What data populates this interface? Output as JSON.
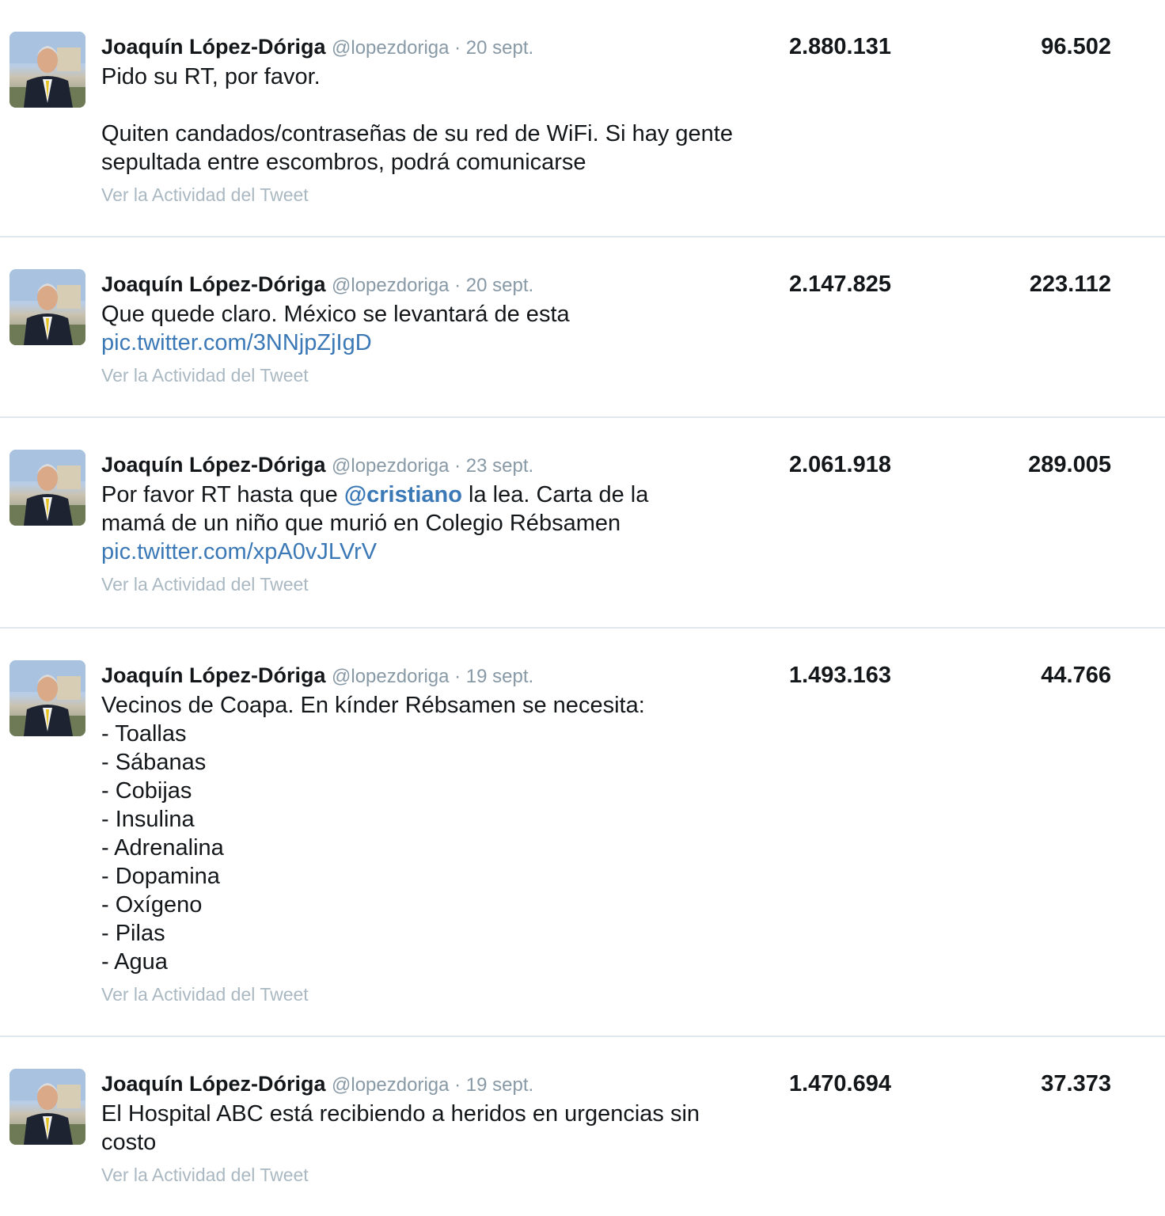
{
  "tweets": [
    {
      "name": "Joaquín López-Dóriga",
      "handle": "@lopezdoriga",
      "sep": " · ",
      "date": "20 sept.",
      "text_parts": [
        {
          "type": "text",
          "value": "Pido su RT, por favor.\n\nQuiten candados/contraseñas de su red de WiFi. Si hay gente sepultada entre escombros, podrá comunicarse"
        }
      ],
      "activity_label": "Ver la Actividad del Tweet",
      "impressions": "2.880.131",
      "engagements": "96.502"
    },
    {
      "name": "Joaquín López-Dóriga",
      "handle": "@lopezdoriga",
      "sep": " · ",
      "date": "20 sept.",
      "text_parts": [
        {
          "type": "text",
          "value": "Que quede claro. México se levantará de esta\n"
        },
        {
          "type": "link",
          "value": "pic.twitter.com/3NNjpZjIgD"
        }
      ],
      "activity_label": "Ver la Actividad del Tweet",
      "impressions": "2.147.825",
      "engagements": "223.112"
    },
    {
      "name": "Joaquín López-Dóriga",
      "handle": "@lopezdoriga",
      "sep": " · ",
      "date": "23 sept.",
      "text_parts": [
        {
          "type": "text",
          "value": "Por favor RT hasta que "
        },
        {
          "type": "mention",
          "value": "@cristiano"
        },
        {
          "type": "text",
          "value": " la lea. Carta de la\nmamá de un niño que murió en Colegio Rébsamen\n"
        },
        {
          "type": "link",
          "value": "pic.twitter.com/xpA0vJLVrV"
        }
      ],
      "activity_label": "Ver la Actividad del Tweet",
      "impressions": "2.061.918",
      "engagements": "289.005"
    },
    {
      "name": "Joaquín López-Dóriga",
      "handle": "@lopezdoriga",
      "sep": " · ",
      "date": "19 sept.",
      "text_parts": [
        {
          "type": "text",
          "value": "Vecinos de Coapa. En kínder Rébsamen se necesita:\n- Toallas\n- Sábanas\n- Cobijas\n- Insulina\n- Adrenalina\n- Dopamina\n- Oxígeno\n- Pilas\n- Agua"
        }
      ],
      "activity_label": "Ver la Actividad del Tweet",
      "impressions": "1.493.163",
      "engagements": "44.766"
    },
    {
      "name": "Joaquín López-Dóriga",
      "handle": "@lopezdoriga",
      "sep": " · ",
      "date": "19 sept.",
      "text_parts": [
        {
          "type": "text",
          "value": "El Hospital ABC está recibiendo a heridos en urgencias sin\ncosto"
        }
      ],
      "activity_label": "Ver la Actividad del Tweet",
      "impressions": "1.470.694",
      "engagements": "37.373"
    }
  ]
}
